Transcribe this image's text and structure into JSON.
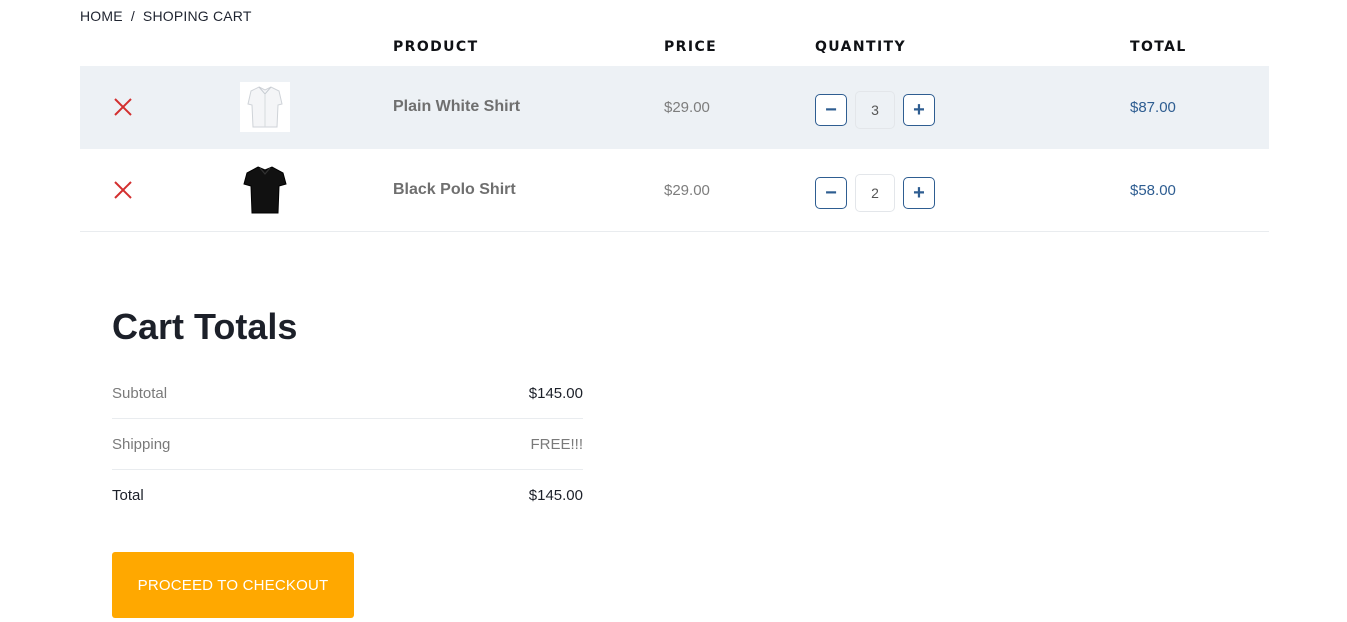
{
  "breadcrumb": {
    "home": "HOME",
    "separator": "/",
    "current": "SHOPING CART"
  },
  "cart": {
    "headers": {
      "product": "PRODUCT",
      "price": "PRICE",
      "quantity": "QUANTITY",
      "total": "TOTAL"
    },
    "items": [
      {
        "name": "Plain White Shirt",
        "price": "$29.00",
        "quantity": "3",
        "total": "$87.00",
        "thumbnail": "white-shirt-image"
      },
      {
        "name": "Black Polo Shirt",
        "price": "$29.00",
        "quantity": "2",
        "total": "$58.00",
        "thumbnail": "black-polo-image"
      }
    ],
    "controls": {
      "remove_icon": "close-icon",
      "decrease_symbol": "−",
      "increase_symbol": "+"
    }
  },
  "totals": {
    "title": "Cart Totals",
    "subtotal_label": "Subtotal",
    "subtotal_value": "$145.00",
    "shipping_label": "Shipping",
    "shipping_value": "FREE!!!",
    "total_label": "Total",
    "total_value": "$145.00"
  },
  "checkout": {
    "label": "PROCEED TO CHECKOUT"
  },
  "colors": {
    "accent": "#2e5d91",
    "checkout": "#ffa800",
    "remove": "#d32f2f",
    "row_shade": "#edf1f5"
  }
}
